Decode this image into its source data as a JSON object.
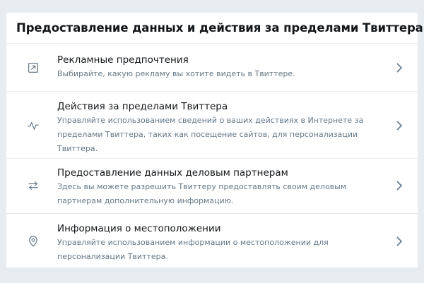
{
  "section": {
    "title": "Предоставление данных и действия за пределами Твиттера"
  },
  "items": [
    {
      "icon": "external-link-icon",
      "title": "Рекламные предпочтения",
      "description": "Выбирайте, какую рекламу вы хотите видеть в Твиттере."
    },
    {
      "icon": "activity-icon",
      "title": "Действия за пределами Твиттера",
      "description": "Управляйте использованием сведений о ваших действиях в Интернете за пределами Твиттера, таких как посещение сайтов, для персонализации Твиттера."
    },
    {
      "icon": "swap-arrows-icon",
      "title": "Предоставление данных деловым партнерам",
      "description": "Здесь вы можете разрешить Твиттеру предоставлять своим деловым партнерам дополнительную информацию."
    },
    {
      "icon": "location-pin-icon",
      "title": "Информация о местоположении",
      "description": "Управляйте использованием информации о местоположении для персонализации Твиттера."
    }
  ],
  "colors": {
    "background": "#e6ecf0",
    "panel": "#ffffff",
    "title_text": "#14171a",
    "secondary_text": "#657786",
    "icon": "#657786"
  }
}
